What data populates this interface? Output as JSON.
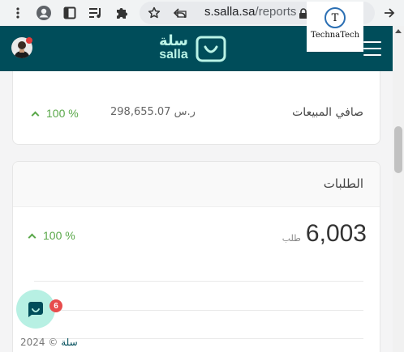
{
  "browser": {
    "url_host": "s.salla.sa",
    "url_path": "/reports",
    "icons": [
      "menu-dots-icon",
      "profile-icon",
      "sidebar-icon",
      "media-control-icon",
      "extensions-icon",
      "bookmark-star-icon",
      "share-icon",
      "lock-icon",
      "forward-icon"
    ]
  },
  "watermark": {
    "initial": "T",
    "text": "TechnaTech"
  },
  "header": {
    "logo_ar": "سلة",
    "logo_en": "salla",
    "accent": "#004d5a"
  },
  "net_sales": {
    "label": "صافي المبيعات",
    "value": "298,655.07 ر.س",
    "change": "100 %"
  },
  "orders": {
    "title": "الطلبات",
    "value": "6,003",
    "unit": "طلب",
    "change": "100 %"
  },
  "chat": {
    "badge": "6"
  },
  "footer": {
    "copyright": "2024 ©",
    "brand": "سلة"
  },
  "colors": {
    "positive": "#5aa84a",
    "logo_mint": "#baf3e6",
    "badge_red": "#e74c4c"
  }
}
